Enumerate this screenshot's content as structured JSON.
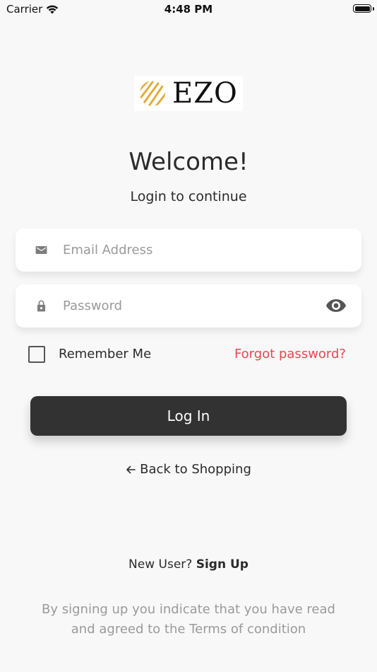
{
  "status_bar": {
    "carrier": "Carrier",
    "time": "4:48 PM"
  },
  "logo": {
    "text": "EZO",
    "mark_color": "#e0ad3a"
  },
  "header": {
    "title": "Welcome!",
    "subtitle": "Login to continue"
  },
  "form": {
    "email": {
      "icon": "envelope-icon",
      "placeholder": "Email Address",
      "value": ""
    },
    "password": {
      "icon": "lock-icon",
      "placeholder": "Password",
      "value": "",
      "toggle_icon": "eye-icon"
    },
    "remember_label": "Remember Me",
    "remember_checked": false,
    "forgot_label": "Forgot password?",
    "submit_label": "Log In"
  },
  "navigation": {
    "back_label": "Back to Shopping"
  },
  "signup": {
    "prompt": "New User?",
    "link_label": "Sign Up"
  },
  "terms": {
    "text": "By signing up you indicate that you have read and agreed to the Terms of condition"
  },
  "colors": {
    "accent_red": "#e8474f",
    "button_dark": "#323232",
    "background": "#f8f8f8",
    "muted_text": "#9a9a9a"
  }
}
